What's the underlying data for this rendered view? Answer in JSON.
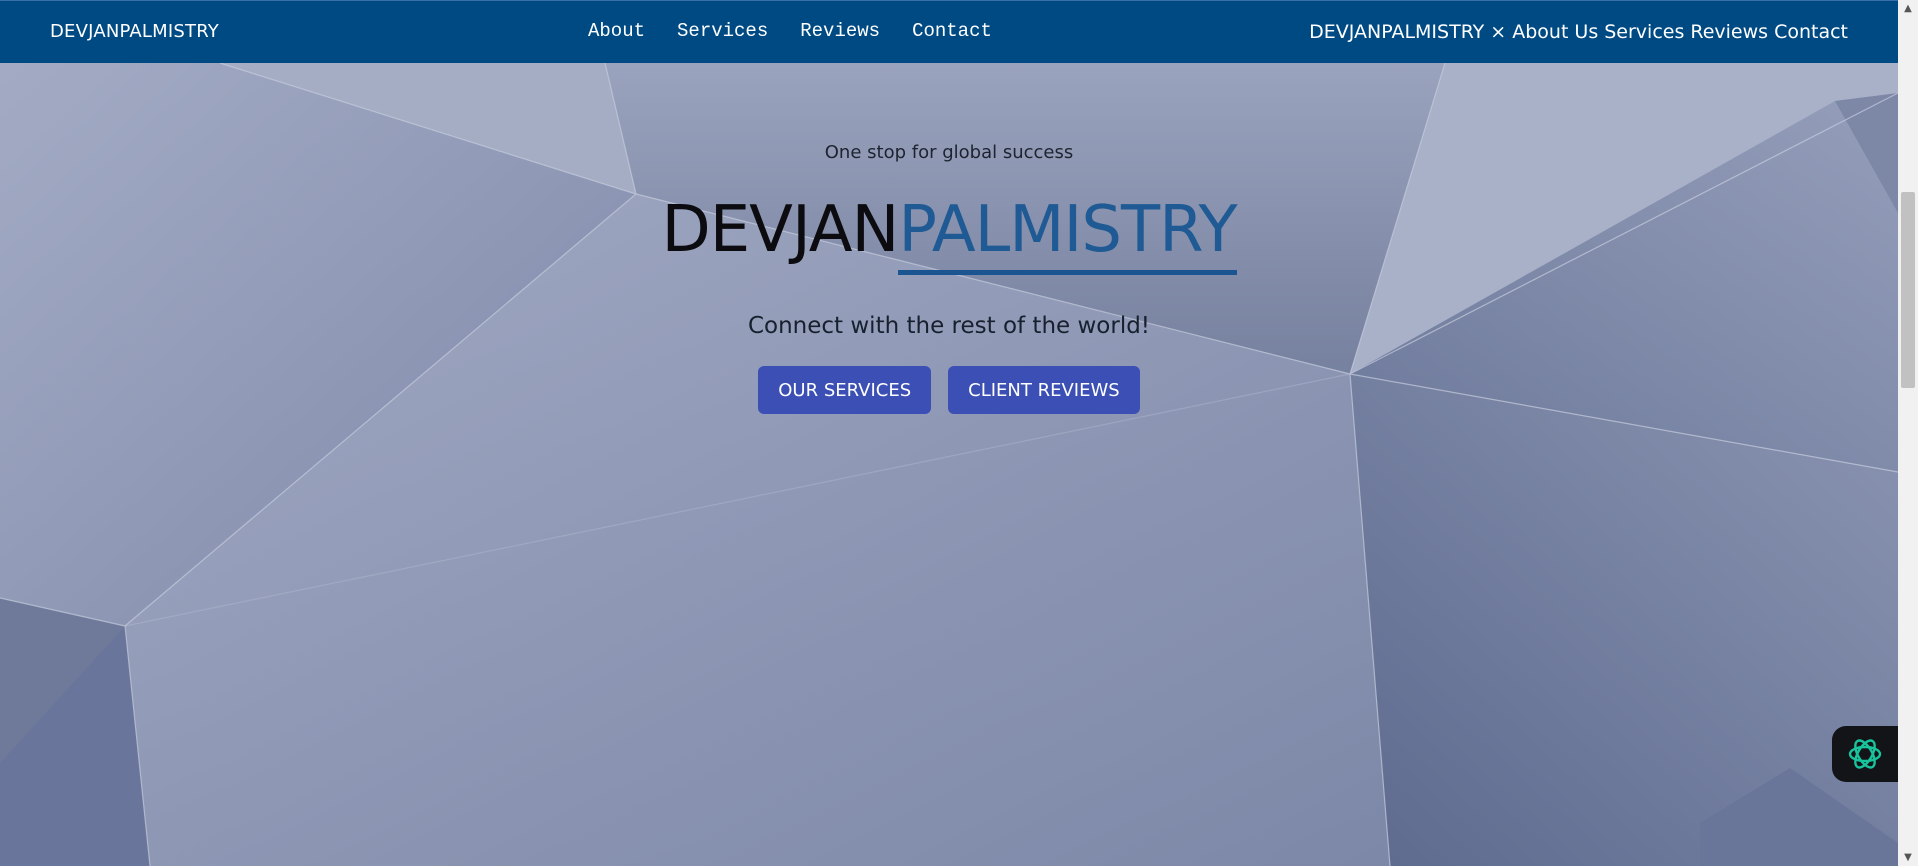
{
  "header": {
    "brand": "DEVJANPALMISTRY",
    "nav": [
      "About",
      "Services",
      "Reviews",
      "Contact"
    ],
    "nav_duplicate": {
      "brand": "DEVJANPALMISTRY",
      "close": "×",
      "items": [
        "About Us",
        "Services",
        "Reviews",
        "Contact"
      ]
    }
  },
  "hero": {
    "tagline": "One stop for global success",
    "headline_dark": "DEVJAN",
    "headline_blue": "PALMISTRY",
    "subtitle": "Connect with the rest of the world!",
    "buttons": [
      "OUR SERVICES",
      "CLIENT REVIEWS"
    ]
  },
  "widget": {
    "icon": "openai-knot-icon"
  },
  "colors": {
    "header_bg": "#004a84",
    "accent_blue": "#1f5a94",
    "button_bg": "#3b4fb4",
    "widget_icon": "#19c39c"
  }
}
